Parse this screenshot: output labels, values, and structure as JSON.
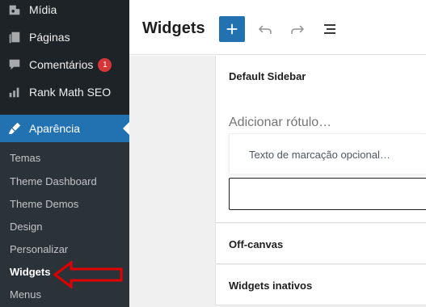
{
  "sidebar": {
    "items": [
      {
        "label": "Mídia",
        "icon": "media-icon"
      },
      {
        "label": "Páginas",
        "icon": "pages-icon"
      },
      {
        "label": "Comentários",
        "icon": "comments-icon",
        "badge": "1"
      },
      {
        "label": "Rank Math SEO",
        "icon": "rank-math-icon"
      },
      {
        "label": "Aparência",
        "icon": "paintbrush-icon",
        "active": true
      }
    ],
    "submenu": [
      "Temas",
      "Theme Dashboard",
      "Theme Demos",
      "Design",
      "Personalizar",
      "Widgets",
      "Menus"
    ],
    "current_submenu": "Widgets"
  },
  "header": {
    "title": "Widgets"
  },
  "editor": {
    "sections": [
      {
        "title": "Default Sidebar"
      },
      {
        "title": "Off-canvas"
      },
      {
        "title": "Widgets inativos"
      }
    ],
    "label_placeholder": "Adicionar rótulo…",
    "markup_placeholder": "Texto de marcação opcional…"
  },
  "colors": {
    "admin_bg": "#1d2327",
    "submenu_bg": "#2c3338",
    "accent": "#2271b1",
    "badge": "#d63638",
    "annotation": "#e00000"
  }
}
